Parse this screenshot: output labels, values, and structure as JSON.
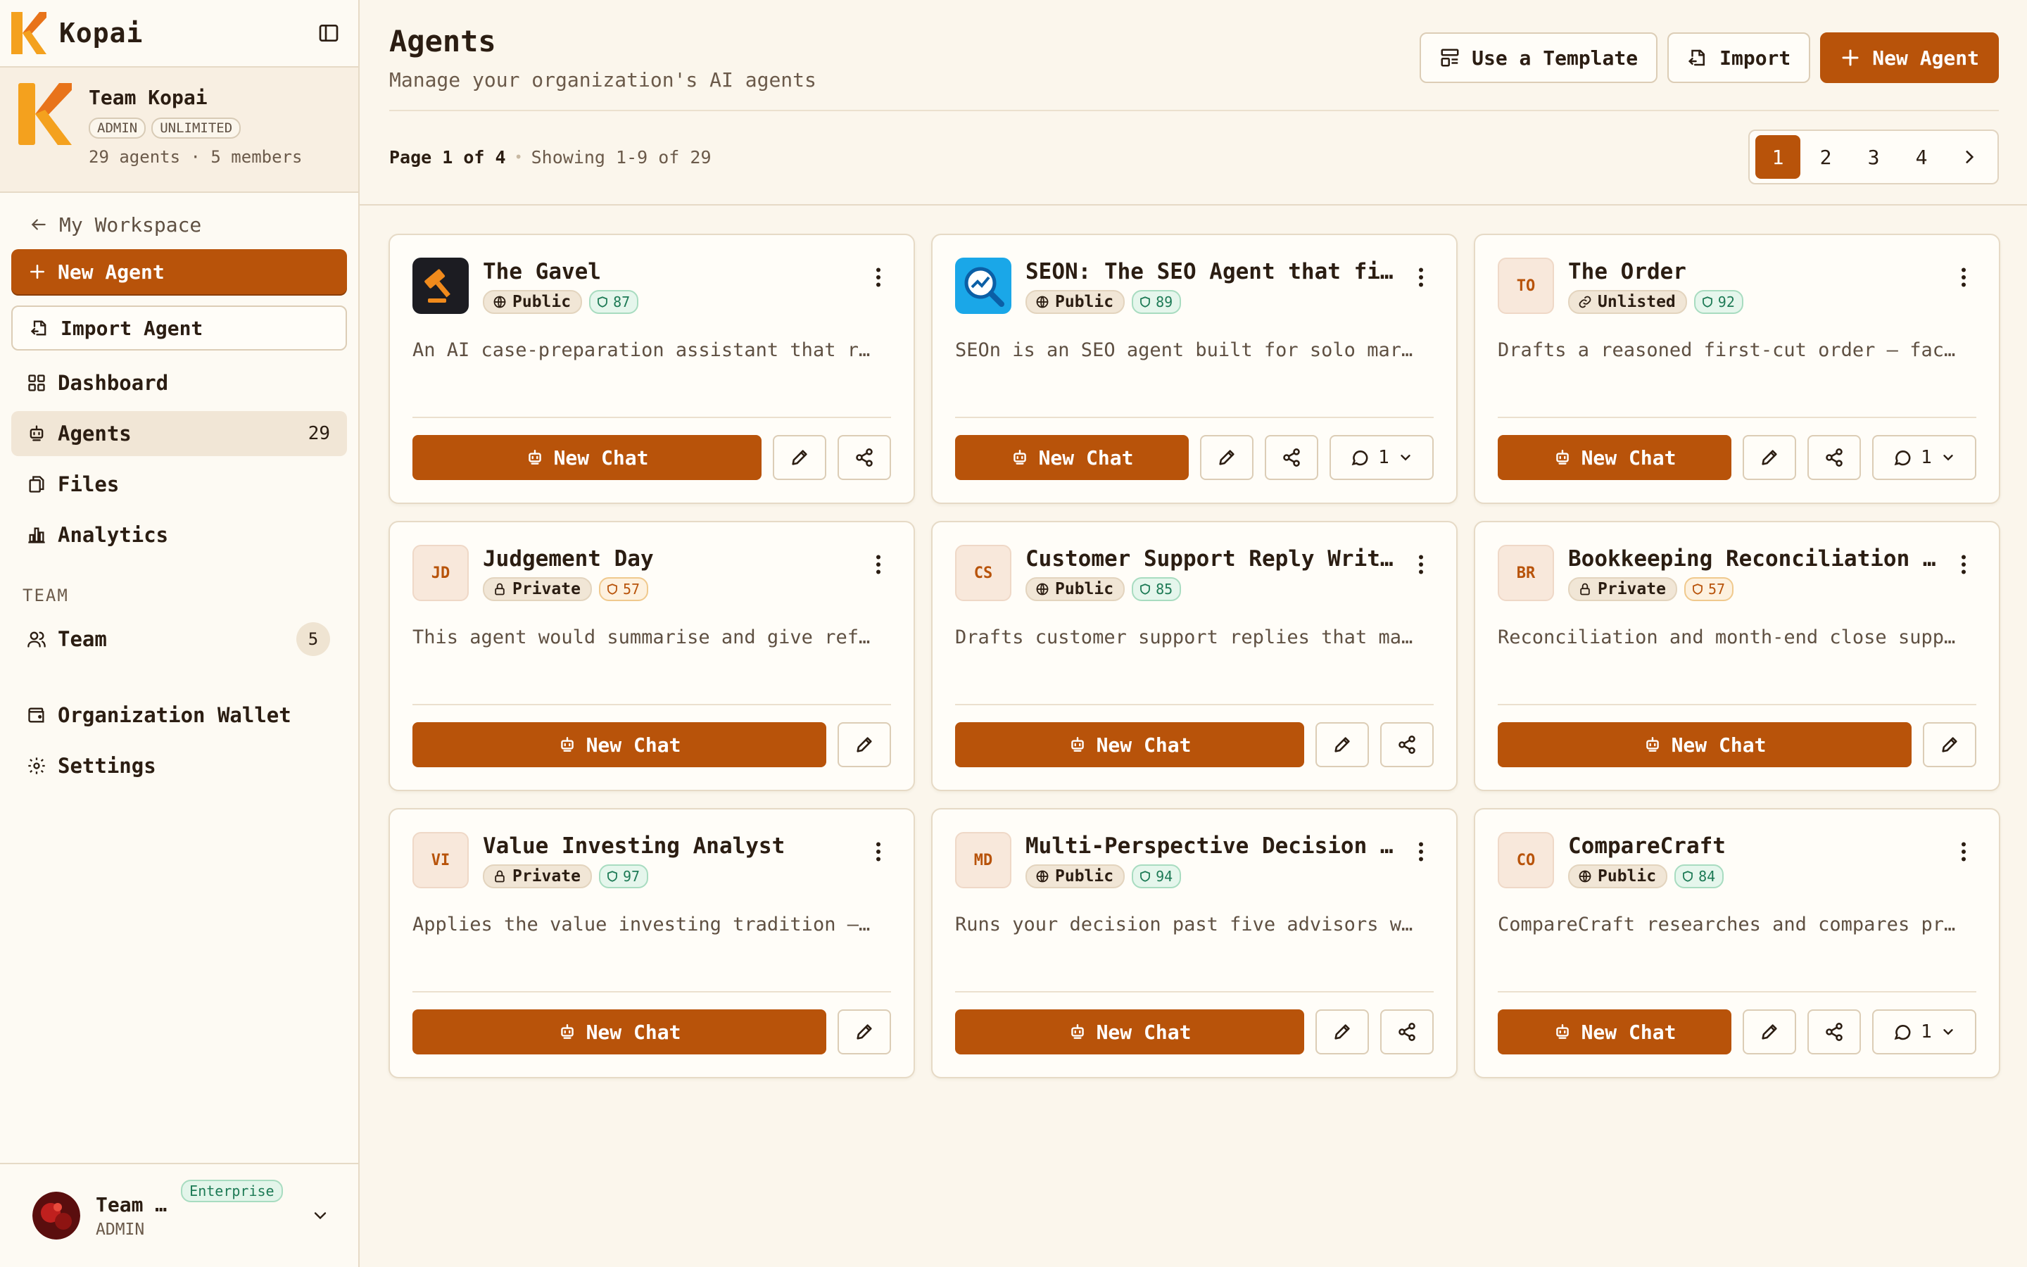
{
  "app": {
    "name": "Kopai"
  },
  "team": {
    "name": "Team Kopai",
    "badges": [
      "ADMIN",
      "UNLIMITED"
    ],
    "meta": "29 agents · 5 members"
  },
  "nav": {
    "back": "My Workspace",
    "new_agent": "New Agent",
    "import_agent": "Import Agent",
    "items": [
      {
        "label": "Dashboard",
        "icon": "dashboard-icon"
      },
      {
        "label": "Agents",
        "icon": "bot-icon",
        "count": "29"
      },
      {
        "label": "Files",
        "icon": "files-icon"
      },
      {
        "label": "Analytics",
        "icon": "bar-chart-icon"
      }
    ],
    "team_section": "TEAM",
    "team_item": {
      "label": "Team",
      "count": "5"
    },
    "wallet": "Organization Wallet",
    "settings": "Settings"
  },
  "user": {
    "name": "Team …",
    "role": "ADMIN",
    "plan": "Enterprise"
  },
  "header": {
    "title": "Agents",
    "subtitle": "Manage your organization's AI agents",
    "template_btn": "Use a Template",
    "import_btn": "Import",
    "new_agent_btn": "New Agent"
  },
  "pagination": {
    "info": "Page 1 of 4",
    "showing": "Showing 1-9 of 29",
    "pages": [
      "1",
      "2",
      "3",
      "4"
    ],
    "current": "1"
  },
  "agents": [
    {
      "name": "The Gavel",
      "visibility": "Public",
      "score": "87",
      "score_tone": "green",
      "desc": "An AI case-preparation assistant that r…",
      "icon": "gavel-logo",
      "initials": "",
      "chat": "New Chat",
      "share": true,
      "threads": ""
    },
    {
      "name": "SEON: The SEO Agent that fix…",
      "visibility": "Public",
      "score": "89",
      "score_tone": "green",
      "desc": "SEOn is an SEO agent built for solo mar…",
      "icon": "seo-logo",
      "initials": "",
      "chat": "New Chat",
      "share": true,
      "threads": "1"
    },
    {
      "name": "The Order",
      "visibility": "Unlisted",
      "score": "92",
      "score_tone": "green",
      "desc": "Drafts a reasoned first-cut order — fac…",
      "icon": "",
      "initials": "TO",
      "chat": "New Chat",
      "share": true,
      "threads": "1"
    },
    {
      "name": "Judgement Day",
      "visibility": "Private",
      "score": "57",
      "score_tone": "amber",
      "desc": "This agent would summarise and give ref…",
      "icon": "",
      "initials": "JD",
      "chat": "New Chat",
      "share": false,
      "threads": ""
    },
    {
      "name": "Customer Support Reply Writer",
      "visibility": "Public",
      "score": "85",
      "score_tone": "green",
      "desc": "Drafts customer support replies that ma…",
      "icon": "",
      "initials": "CS",
      "chat": "New Chat",
      "share": true,
      "threads": ""
    },
    {
      "name": "Bookkeeping Reconciliation A…",
      "visibility": "Private",
      "score": "57",
      "score_tone": "amber",
      "desc": "Reconciliation and month-end close supp…",
      "icon": "",
      "initials": "BR",
      "chat": "New Chat",
      "share": false,
      "threads": ""
    },
    {
      "name": "Value Investing Analyst",
      "visibility": "Private",
      "score": "97",
      "score_tone": "green",
      "desc": "Applies the value investing tradition —…",
      "icon": "",
      "initials": "VI",
      "chat": "New Chat",
      "share": false,
      "threads": ""
    },
    {
      "name": "Multi-Perspective Decision A…",
      "visibility": "Public",
      "score": "94",
      "score_tone": "green",
      "desc": "Runs your decision past five advisors w…",
      "icon": "",
      "initials": "MD",
      "chat": "New Chat",
      "share": true,
      "threads": ""
    },
    {
      "name": "CompareCraft",
      "visibility": "Public",
      "score": "84",
      "score_tone": "green",
      "desc": "CompareCraft researches and compares pr…",
      "icon": "",
      "initials": "CO",
      "chat": "New Chat",
      "share": true,
      "threads": "1"
    }
  ],
  "colors": {
    "accent": "#b8530a",
    "background": "#fbf6ec",
    "success": "#1d7a55"
  }
}
